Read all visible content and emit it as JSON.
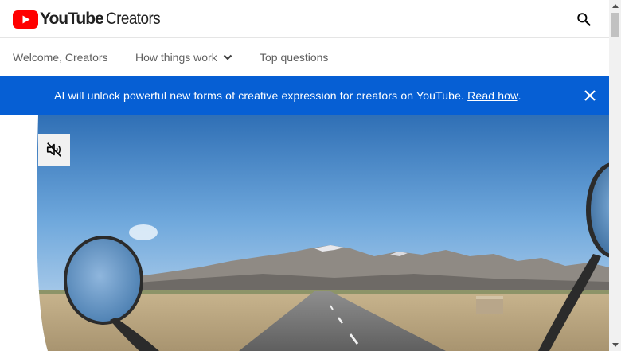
{
  "header": {
    "logo_word": "YouTube",
    "logo_sub": "Creators",
    "search_icon": "search-icon",
    "brand_color": "#ff0000"
  },
  "nav": {
    "items": [
      {
        "label": "Welcome, Creators"
      },
      {
        "label": "How things work",
        "icon": "chevron-down-icon"
      },
      {
        "label": "Top questions"
      }
    ]
  },
  "banner": {
    "text": "AI will unlock powerful new forms of creative expression for creators on YouTube. ",
    "link_label": "Read how",
    "trailing": ".",
    "close_icon": "close-icon",
    "background": "#065fd4"
  },
  "hero": {
    "mute_icon": "volume-off-icon",
    "image": "motorcycle-road-mountains-video"
  }
}
